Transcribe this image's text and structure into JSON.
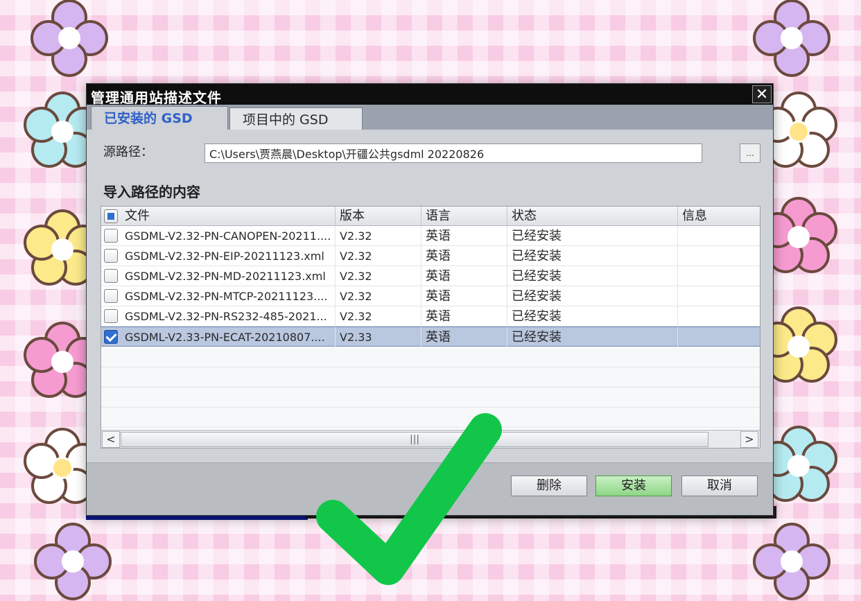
{
  "dialog": {
    "title": "管理通用站描述文件",
    "close_label": "✕"
  },
  "tabs": [
    {
      "label": "已安装的 GSD",
      "active": true
    },
    {
      "label": "项目中的 GSD",
      "active": false
    }
  ],
  "path": {
    "label": "源路径：",
    "value": "C:\\Users\\贾燕晨\\Desktop\\开疆公共gsdml 20220826",
    "browse_label": "..."
  },
  "section_title": "导入路径的内容",
  "table": {
    "headers": [
      "文件",
      "版本",
      "语言",
      "状态",
      "信息"
    ],
    "rows": [
      {
        "file": "GSDML-V2.32-PN-CANOPEN-20211....",
        "version": "V2.32",
        "language": "英语",
        "status": "已经安装",
        "info": "",
        "checked": false
      },
      {
        "file": "GSDML-V2.32-PN-EIP-20211123.xml",
        "version": "V2.32",
        "language": "英语",
        "status": "已经安装",
        "info": "",
        "checked": false
      },
      {
        "file": "GSDML-V2.32-PN-MD-20211123.xml",
        "version": "V2.32",
        "language": "英语",
        "status": "已经安装",
        "info": "",
        "checked": false
      },
      {
        "file": "GSDML-V2.32-PN-MTCP-20211123....",
        "version": "V2.32",
        "language": "英语",
        "status": "已经安装",
        "info": "",
        "checked": false
      },
      {
        "file": "GSDML-V2.32-PN-RS232-485-2021...",
        "version": "V2.32",
        "language": "英语",
        "status": "已经安装",
        "info": "",
        "checked": false
      },
      {
        "file": "GSDML-V2.33-PN-ECAT-20210807....",
        "version": "V2.33",
        "language": "英语",
        "status": "已经安装",
        "info": "",
        "checked": true
      }
    ],
    "scroll_left": "<",
    "scroll_right": ">",
    "scroll_grip": "|||"
  },
  "buttons": {
    "delete": "删除",
    "install": "安装",
    "cancel": "取消"
  },
  "colors": {
    "accent_tab": "#3060c8",
    "install_button": "#8fd587",
    "checkmark": "#12c64a"
  }
}
